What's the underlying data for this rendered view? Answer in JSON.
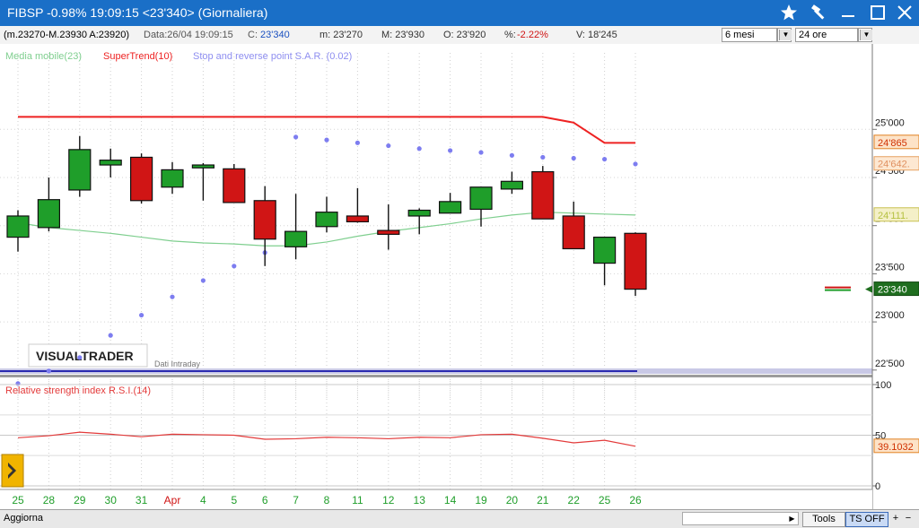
{
  "window": {
    "title": "FIBSP  -0.98%  19:09:15   <23'340>  (Giornaliera)",
    "icons": [
      "star-icon",
      "hammer-icon",
      "minimize-icon",
      "maximize-icon",
      "close-icon"
    ]
  },
  "infobar": {
    "range": "(m.23270-M.23930 A:23920)",
    "data_label": "Data:26/04 19:09:15",
    "c_label": "C:",
    "c_value": "23'340",
    "m_label": "m: 23'270",
    "M_label": "M: 23'930",
    "o_label": "O: 23'920",
    "pct_label": "%:",
    "pct_value": "-2.22%",
    "v_label": "V: 18'245",
    "period_select": "6 mesi",
    "interval_select": "24 ore"
  },
  "colors": {
    "up": "#1f9e2a",
    "down": "#d01515",
    "ma": "#7fcf8f",
    "supertrend": "#ee2222",
    "sar": "#7d7df0",
    "rsi": "#e33a3a",
    "title_bg": "#1a6fc7"
  },
  "chart_data": {
    "type": "candlestick",
    "dates": [
      "25",
      "28",
      "29",
      "30",
      "31",
      "Apr",
      "4",
      "5",
      "6",
      "7",
      "8",
      "11",
      "12",
      "13",
      "14",
      "19",
      "20",
      "21",
      "22",
      "25",
      "26"
    ],
    "ohlc": [
      {
        "o": 23880,
        "h": 24160,
        "l": 23730,
        "c": 24100
      },
      {
        "o": 23980,
        "h": 24500,
        "l": 23940,
        "c": 24270
      },
      {
        "o": 24370,
        "h": 24930,
        "l": 24300,
        "c": 24790
      },
      {
        "o": 24630,
        "h": 24800,
        "l": 24500,
        "c": 24680
      },
      {
        "o": 24710,
        "h": 24750,
        "l": 24230,
        "c": 24260
      },
      {
        "o": 24400,
        "h": 24660,
        "l": 24330,
        "c": 24580
      },
      {
        "o": 24600,
        "h": 24650,
        "l": 24260,
        "c": 24630
      },
      {
        "o": 24590,
        "h": 24640,
        "l": 24240,
        "c": 24240
      },
      {
        "o": 24260,
        "h": 24410,
        "l": 23580,
        "c": 23860
      },
      {
        "o": 23780,
        "h": 24330,
        "l": 23650,
        "c": 23940
      },
      {
        "o": 23990,
        "h": 24300,
        "l": 23930,
        "c": 24140
      },
      {
        "o": 24100,
        "h": 24390,
        "l": 24030,
        "c": 24040
      },
      {
        "o": 23950,
        "h": 24220,
        "l": 23750,
        "c": 23910
      },
      {
        "o": 24100,
        "h": 24180,
        "l": 23910,
        "c": 24160
      },
      {
        "o": 24130,
        "h": 24340,
        "l": 24130,
        "c": 24250
      },
      {
        "o": 24170,
        "h": 24400,
        "l": 23990,
        "c": 24400
      },
      {
        "o": 24380,
        "h": 24560,
        "l": 24330,
        "c": 24460
      },
      {
        "o": 24560,
        "h": 24620,
        "l": 24070,
        "c": 24070
      },
      {
        "o": 24100,
        "h": 24250,
        "l": 23760,
        "c": 23760
      },
      {
        "o": 23610,
        "h": 23880,
        "l": 23380,
        "c": 23880
      },
      {
        "o": 23920,
        "h": 23930,
        "l": 23270,
        "c": 23340
      }
    ],
    "moving_average": [
      24030,
      23980,
      23950,
      23920,
      23880,
      23840,
      23820,
      23810,
      23790,
      23790,
      23830,
      23890,
      23940,
      23980,
      24020,
      24070,
      24110,
      24140,
      24130,
      24120,
      24110
    ],
    "supertrend": [
      25130,
      25130,
      25130,
      25130,
      25130,
      25130,
      25130,
      25130,
      25130,
      25130,
      25130,
      25130,
      25130,
      25130,
      25130,
      25130,
      25130,
      25130,
      25070,
      24860,
      24860
    ],
    "sar": [
      22360,
      22490,
      22630,
      22860,
      23070,
      23260,
      23430,
      23580,
      23720,
      24920,
      24890,
      24860,
      24830,
      24800,
      24780,
      24760,
      24730,
      24710,
      24700,
      24690,
      24640
    ],
    "price_axis": {
      "ticks": [
        "25'000",
        "24'500",
        "24'000",
        "23'500",
        "23'000",
        "22'500"
      ],
      "ylim": [
        22250,
        25400
      ]
    },
    "badges": [
      {
        "label": "24'865",
        "value": 24865
      },
      {
        "label": "24'642.",
        "value": 24642
      },
      {
        "label": "24'111.",
        "value": 24111
      },
      {
        "label": "23'340",
        "value": 23340
      }
    ],
    "legend": [
      {
        "name": "Media mobile(23)"
      },
      {
        "name": "SuperTrend(10)"
      },
      {
        "name": "Stop and reverse point S.A.R. (0.02)"
      }
    ],
    "watermark": "VISUALTRADER",
    "sub_watermark": "Dati Intraday",
    "rsi": {
      "name": "Relative strength index R.S.I.(14)",
      "values": [
        47.5,
        49.5,
        53,
        51,
        48.5,
        51,
        50.5,
        50,
        46,
        46.5,
        48,
        47.5,
        46.5,
        48,
        47.5,
        50.5,
        51,
        47,
        42.5,
        45,
        39.1032
      ],
      "ticks": [
        "100",
        "50",
        "0"
      ],
      "ylim": [
        0,
        100
      ],
      "badge": "39.1032"
    }
  },
  "bottombar": {
    "aggiorna": "Aggiorna",
    "tools": "Tools",
    "tsoff": "TS OFF"
  }
}
